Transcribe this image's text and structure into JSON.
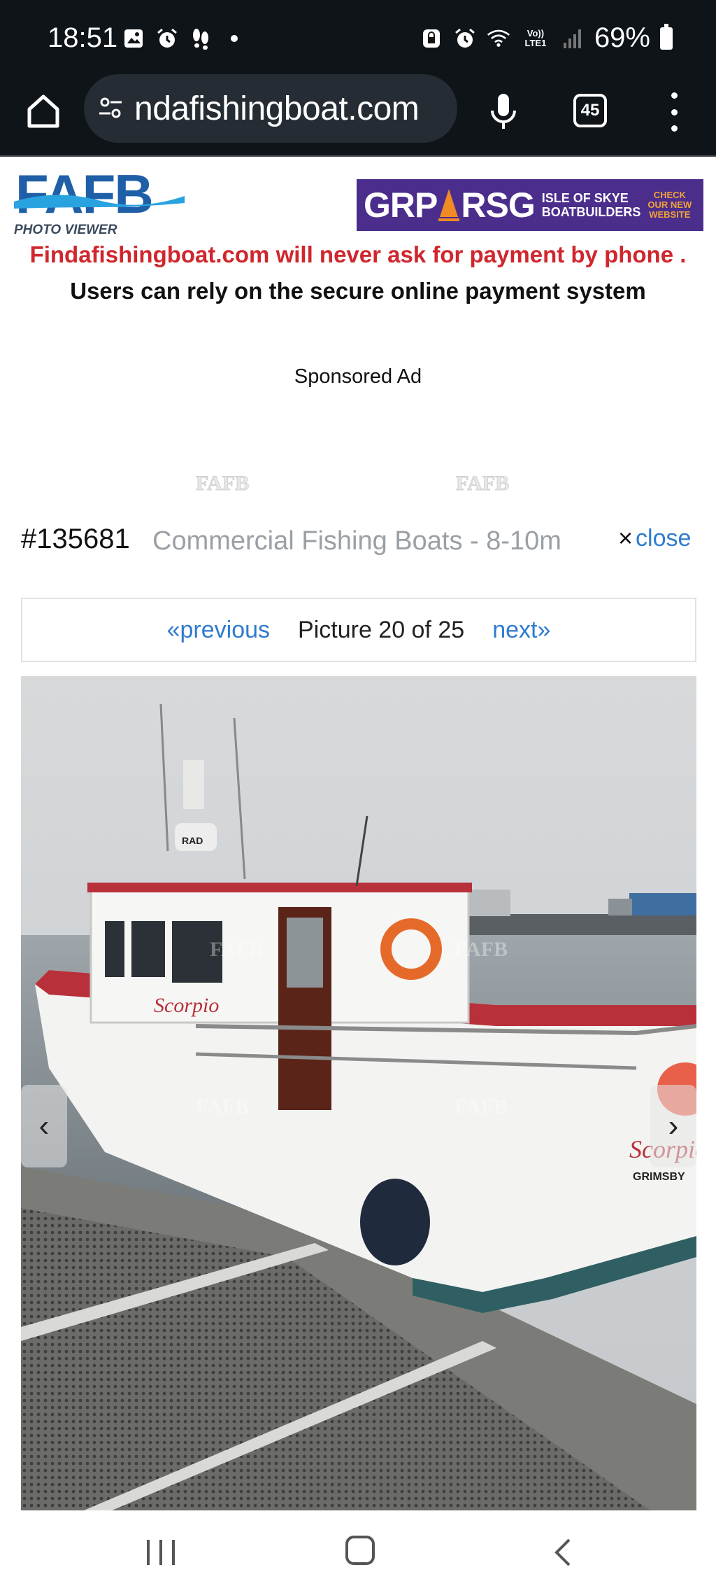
{
  "status_bar": {
    "time": "18:51",
    "battery": "69%",
    "left_icons": [
      "image-icon",
      "alarm-icon",
      "steps-icon",
      "dot-icon"
    ],
    "right_icons": [
      "lock-icon",
      "alarm-icon",
      "wifi-icon",
      "volte-icon",
      "signal-icon",
      "battery-icon"
    ],
    "volte_label": "Vo)) LTE1"
  },
  "browser": {
    "url": "ndafishingboat.com",
    "tab_count": "45"
  },
  "header": {
    "logo_text": "FAFB",
    "logo_subtitle": "PHOTO VIEWER",
    "ad": {
      "grp": "GRP",
      "rsg": "RSG",
      "skye_line1": "ISLE OF SKYE",
      "skye_line2": "BOATBUILDERS",
      "check_line1": "CHECK",
      "check_line2": "OUR NEW",
      "check_line3": "WEBSITE"
    }
  },
  "notices": {
    "warning": "Findafishingboat.com will never ask for payment by phone .",
    "secure": "Users can rely on the secure online payment system",
    "sponsored": "Sponsored Ad"
  },
  "watermarks": [
    "FAFB",
    "FAFB"
  ],
  "listing": {
    "id": "#135681",
    "category": "Commercial Fishing Boats - 8-10m",
    "close_label": "close",
    "close_symbol": "×"
  },
  "pager": {
    "previous": "«previous",
    "count": "Picture 20 of 25",
    "next": "next»"
  },
  "photo": {
    "boat_name": "Scorpio",
    "port": "GRIMSBY",
    "watermark": "FAFB",
    "radome_label": "RAD",
    "arrow_left": "‹",
    "arrow_right": "›"
  },
  "colors": {
    "accent_link": "#2f7bd0",
    "warning_red": "#d0262d",
    "status_bg": "#0f1419",
    "ad_purple": "#4b2d8c"
  }
}
